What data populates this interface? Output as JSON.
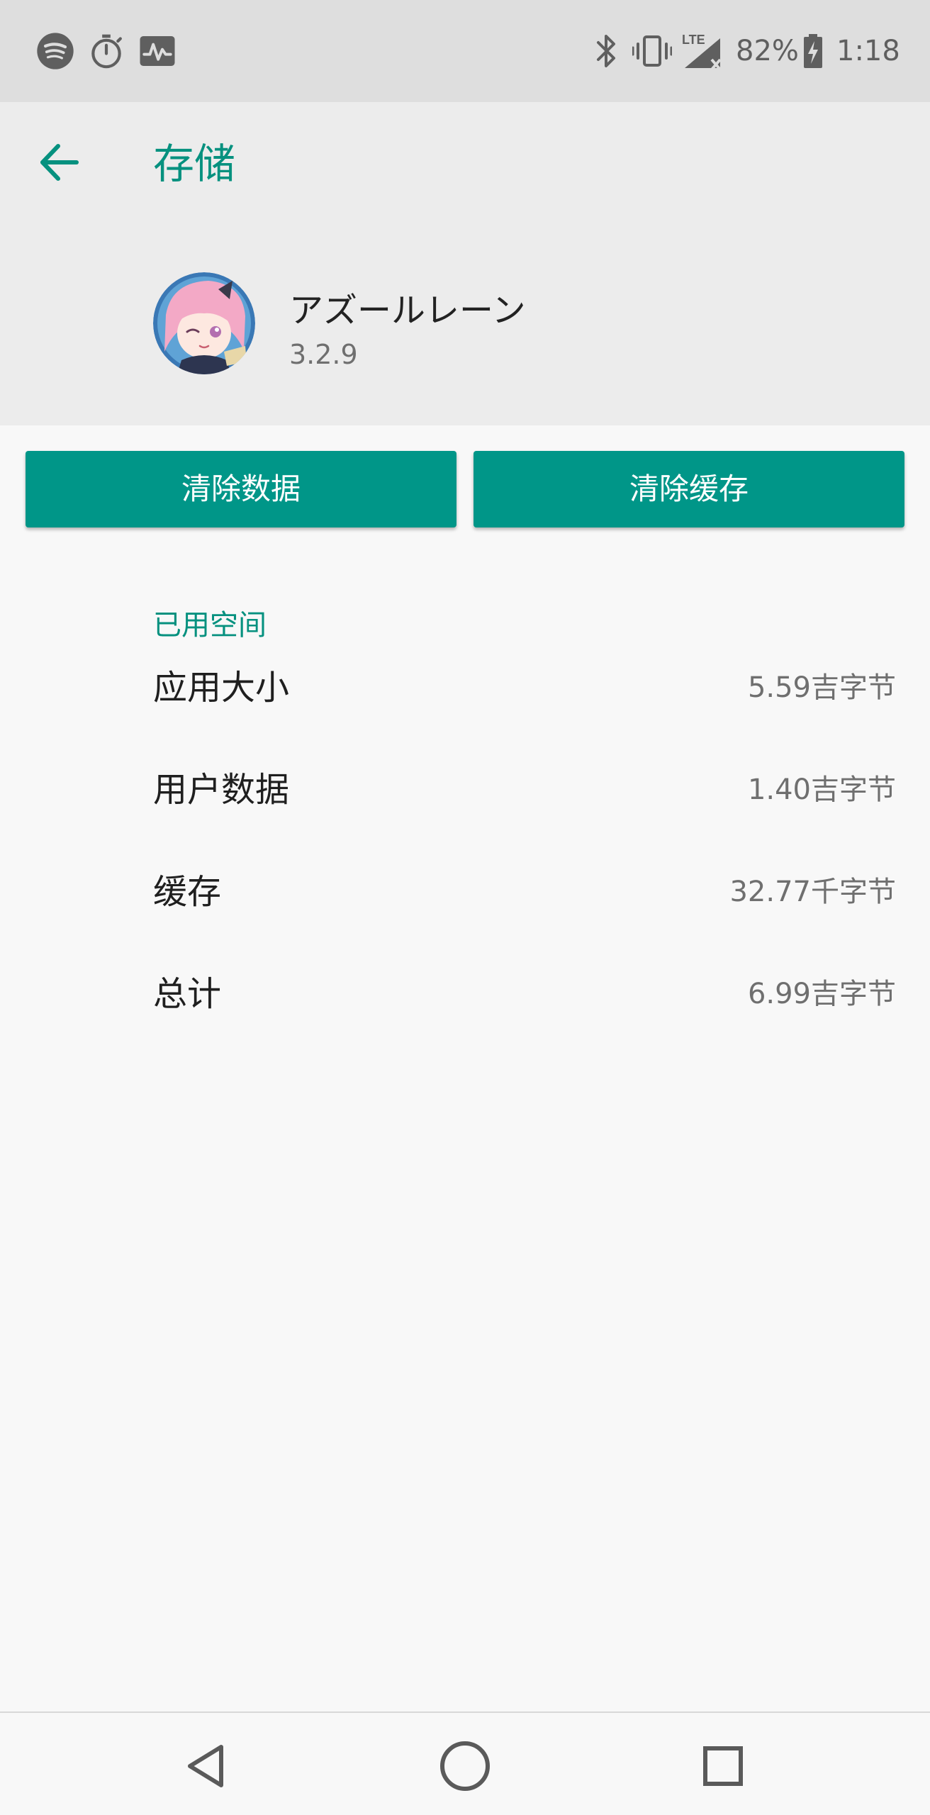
{
  "status_bar": {
    "battery": "82%",
    "time": "1:18",
    "network_label": "LTE",
    "icons": [
      "spotify-icon",
      "stopwatch-icon",
      "activity-monitor-icon",
      "bluetooth-icon",
      "vibrate-icon",
      "lte-signal-icon",
      "battery-charging-icon"
    ]
  },
  "header": {
    "title": "存储",
    "back_icon": "arrow-left-icon"
  },
  "app": {
    "name": "アズールレーン",
    "version": "3.2.9"
  },
  "actions": {
    "clear_data": "清除数据",
    "clear_cache": "清除缓存"
  },
  "storage": {
    "section_title": "已用空间",
    "rows": [
      {
        "label": "应用大小",
        "value": "5.59吉字节"
      },
      {
        "label": "用户数据",
        "value": "1.40吉字节"
      },
      {
        "label": "缓存",
        "value": "32.77千字节"
      },
      {
        "label": "总计",
        "value": "6.99吉字节"
      }
    ]
  },
  "nav": {
    "icons": [
      "back-triangle-icon",
      "home-circle-icon",
      "recents-square-icon"
    ]
  },
  "colors": {
    "accent": "#009688",
    "accent_text": "#06917f",
    "status_bar_bg": "#dedede",
    "header_bg": "#ececec",
    "page_bg": "#f8f8f8"
  }
}
